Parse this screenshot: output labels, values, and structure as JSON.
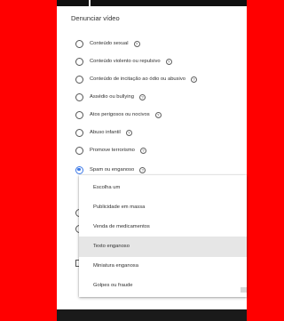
{
  "dialog": {
    "title": "Denunciar vídeo",
    "options": [
      {
        "label": "Conteúdo sexual",
        "selected": false,
        "help": "?"
      },
      {
        "label": "Conteúdo violento ou repulsivo",
        "selected": false,
        "help": "?"
      },
      {
        "label": "Conteúdo de incitação ao ódio ou abusivo",
        "selected": false,
        "help": "?"
      },
      {
        "label": "Assédio ou bullying",
        "selected": false,
        "help": "?"
      },
      {
        "label": "Atos perigosos ou nocivos",
        "selected": false,
        "help": "?"
      },
      {
        "label": "Abuso infantil",
        "selected": false,
        "help": "?"
      },
      {
        "label": "Promove terrorismo",
        "selected": false,
        "help": "?"
      },
      {
        "label": "Spam ou enganoso",
        "selected": true,
        "help": "?"
      }
    ]
  },
  "dropdown": {
    "items": [
      "Escolha um",
      "Publicidade em massa",
      "Venda de medicamentos",
      "Texto enganoso",
      "Miniatura enganosa",
      "Golpes ou fraude"
    ],
    "selected_item": "Texto enganoso"
  },
  "colors": {
    "accent": "#3b78e7",
    "frame": "#ff0000",
    "highlight": "#e6e6e6"
  }
}
